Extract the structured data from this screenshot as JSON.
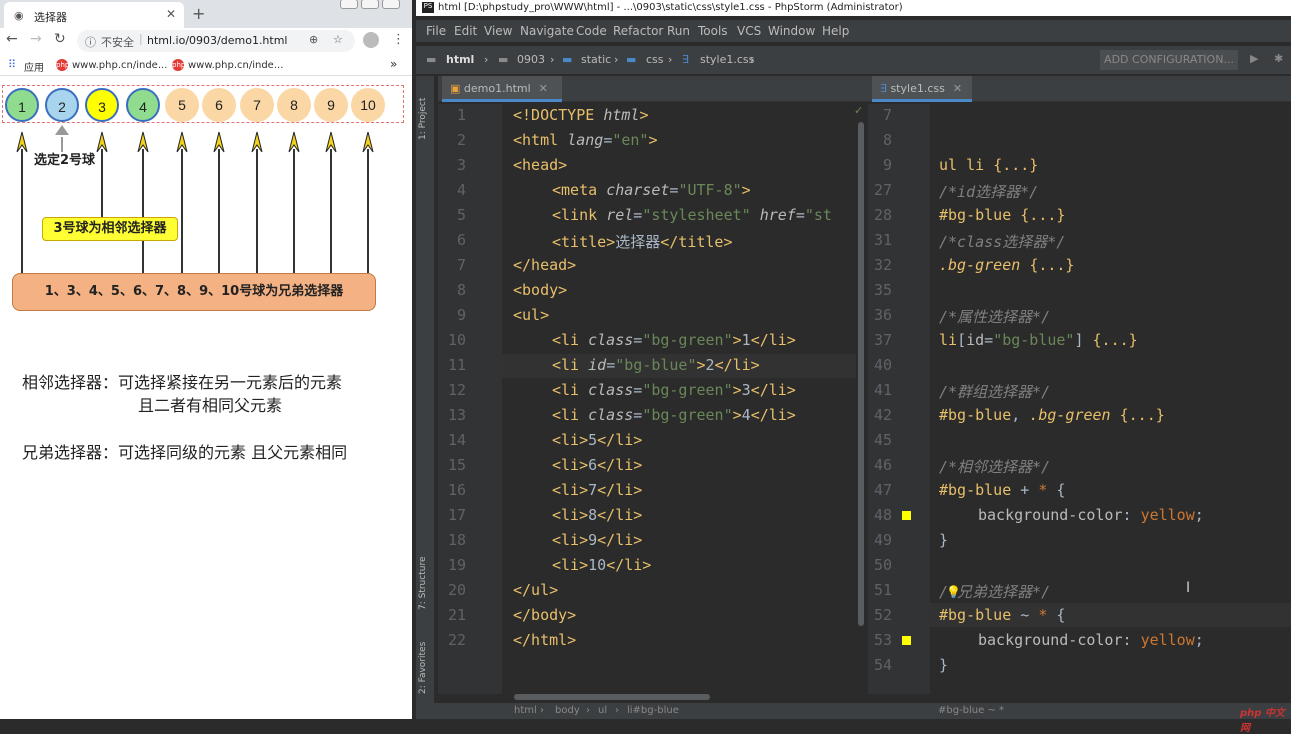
{
  "browser": {
    "tab_title": "选择器",
    "tab_icon": "document-icon",
    "url_insecure": "不安全",
    "url": "html.io/0903/demo1.html",
    "bookmarks_apps": "应用",
    "bookmark1": "www.php.cn/inde...",
    "bookmark2": "www.php.cn/inde...",
    "bookmarks_more": "»"
  },
  "demo": {
    "balls": [
      {
        "label": "1",
        "style": "green"
      },
      {
        "label": "2",
        "style": "blue"
      },
      {
        "label": "3",
        "style": "yellow"
      },
      {
        "label": "4",
        "style": "green"
      },
      {
        "label": "5",
        "style": "plain"
      },
      {
        "label": "6",
        "style": "plain"
      },
      {
        "label": "7",
        "style": "plain"
      },
      {
        "label": "8",
        "style": "plain"
      },
      {
        "label": "9",
        "style": "plain"
      },
      {
        "label": "10",
        "style": "plain"
      }
    ],
    "note_selected": "选定2号球",
    "callout_adjacent": "3号球为相邻选择器",
    "callout_siblings": "1、3、4、5、6、7、8、9、10号球为兄弟选择器",
    "desc_adjacent_1": "相邻选择器：可选择紧接在另一元素后的元素",
    "desc_adjacent_2": "且二者有相同父元素",
    "desc_sibling": "兄弟选择器：可选择同级的元素 且父元素相同"
  },
  "ide": {
    "title": "html [D:\\phpstudy_pro\\WWW\\html] - ...\\0903\\static\\css\\style1.css - PhpStorm (Administrator)",
    "menu": [
      "File",
      "Edit",
      "View",
      "Navigate",
      "Code",
      "Refactor",
      "Run",
      "Tools",
      "VCS",
      "Window",
      "Help"
    ],
    "breadcrumbs": [
      "html",
      "0903",
      "static",
      "css",
      "style1.css"
    ],
    "add_config": "ADD CONFIGURATION...",
    "tab_left": "demo1.html",
    "tab_right": "style1.css",
    "panel_project": "1: Project",
    "panel_structure": "7: Structure",
    "panel_favorites": "2: Favorites",
    "status_left": [
      "html",
      "body",
      "ul",
      "li#bg-blue"
    ],
    "status_right": "#bg-blue ~ *",
    "watermark": "php 中文网"
  }
}
